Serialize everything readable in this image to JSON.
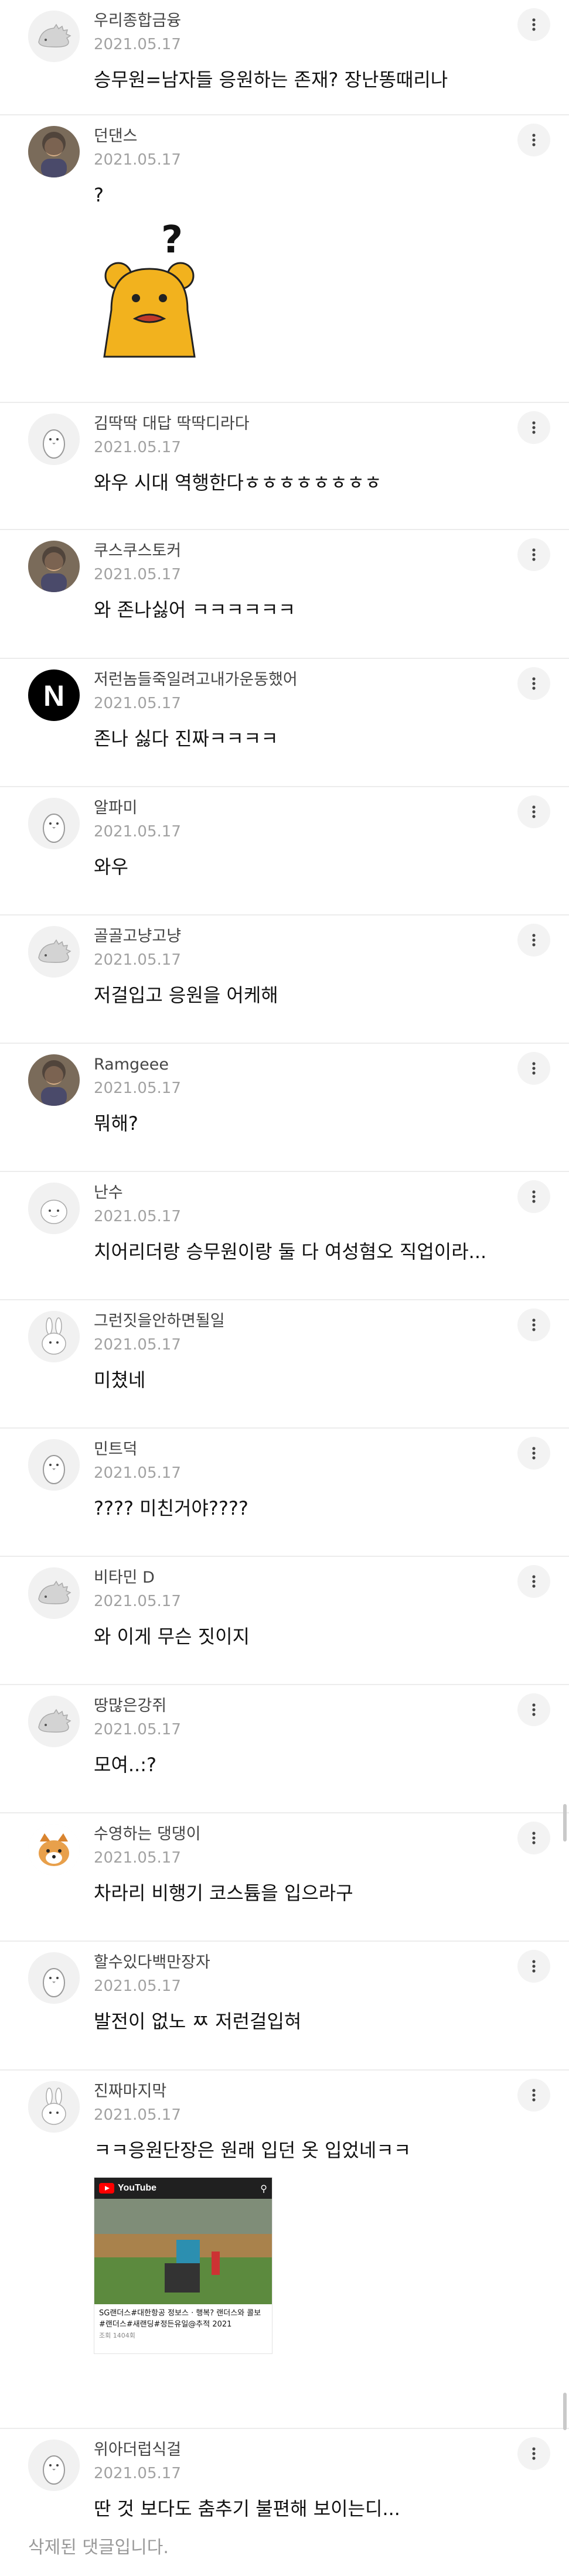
{
  "more_icon": "more-vertical-icon",
  "comments": [
    {
      "nickname": "우리종합금융",
      "date": "2021.05.17",
      "text": "승무원=남자들 응원하는 존재? 장난똥때리나",
      "avatar": "hedgehog-default-avatar"
    },
    {
      "nickname": "던댄스",
      "date": "2021.05.17",
      "text": "?",
      "avatar": "photo-avatar",
      "media": {
        "type": "sticker",
        "name": "confused-bear-sticker",
        "glyph": "?"
      }
    },
    {
      "nickname": "김딱딱 대답 딱딱디라다",
      "date": "2021.05.17",
      "text": "와우 시대 역행한다ㅎㅎㅎㅎㅎㅎㅎㅎ",
      "avatar": "penguin-default-avatar"
    },
    {
      "nickname": "쿠스쿠스토커",
      "date": "2021.05.17",
      "text": "와 존나싫어 ㅋㅋㅋㅋㅋㅋ",
      "avatar": "photo-avatar"
    },
    {
      "nickname": "저런놈들죽일려고내가운동했어",
      "date": "2021.05.17",
      "text": "존나 싫다 진짜ㅋㅋㅋㅋ",
      "avatar": "netflix-avatar",
      "avatar_letter": "N"
    },
    {
      "nickname": "알파미",
      "date": "2021.05.17",
      "text": "와우",
      "avatar": "penguin-default-avatar"
    },
    {
      "nickname": "골골고냥고냥",
      "date": "2021.05.17",
      "text": "저걸입고 응원을 어케해",
      "avatar": "hedgehog-default-avatar"
    },
    {
      "nickname": "Ramgeee",
      "date": "2021.05.17",
      "text": "뭐해?",
      "avatar": "photo-avatar"
    },
    {
      "nickname": "난수",
      "date": "2021.05.17",
      "text": "치어리더랑 승무원이랑 둘 다 여성혐오 직업이라...",
      "avatar": "egg-default-avatar"
    },
    {
      "nickname": "그런짓을안하면될일",
      "date": "2021.05.17",
      "text": "미쳤네",
      "avatar": "rabbit-default-avatar"
    },
    {
      "nickname": "민트덕",
      "date": "2021.05.17",
      "text": "???? 미친거야????",
      "avatar": "penguin-default-avatar"
    },
    {
      "nickname": "비타민 D",
      "date": "2021.05.17",
      "text": "와 이게 무슨 짓이지",
      "avatar": "hedgehog-default-avatar"
    },
    {
      "nickname": "땅많은강쥐",
      "date": "2021.05.17",
      "text": "모여..:?",
      "avatar": "hedgehog-default-avatar"
    },
    {
      "nickname": "수영하는 댕댕이",
      "date": "2021.05.17",
      "text": "차라리 비행기 코스튬을 입으라구",
      "avatar": "dog-avatar"
    },
    {
      "nickname": "할수있다백만장자",
      "date": "2021.05.17",
      "text": "발전이 없노 ㅉ 저런걸입혀",
      "avatar": "penguin-default-avatar"
    },
    {
      "nickname": "진짜마지막",
      "date": "2021.05.17",
      "text": "ㅋㅋ응원단장은 원래 입던 옷 입었네ㅋㅋ",
      "avatar": "rabbit-default-avatar",
      "media": {
        "type": "video",
        "name": "youtube-video-card",
        "brand": "YouTube",
        "caption": "SG랜더스#대한항공 정보스 · 행복? 랜더스와 콜보#랜더스#새랜딩#정든유일@추적 2021",
        "sub": "조회 1404회"
      }
    },
    {
      "nickname": "위아더럽식걸",
      "date": "2021.05.17",
      "text": "딴 것 보다도 춤추기 불편해 보이는디...",
      "avatar": "penguin-default-avatar"
    }
  ],
  "deleted_notice": "삭제된 댓글입니다."
}
